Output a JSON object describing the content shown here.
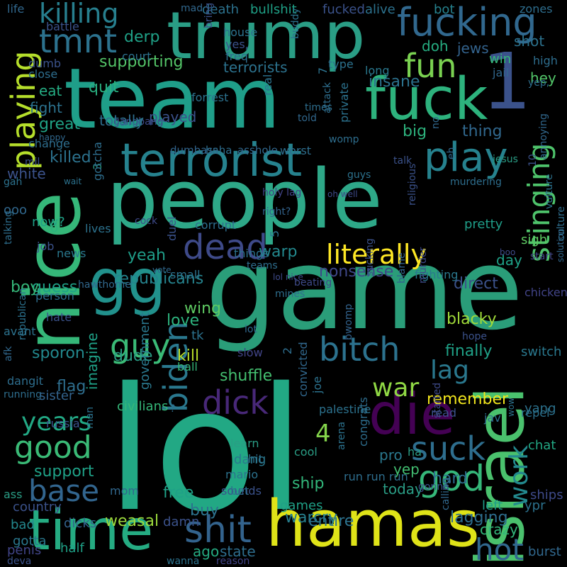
{
  "background": "#000000",
  "words": [
    {
      "text": "lol",
      "color": "#22a884"
    },
    {
      "text": "game",
      "color": "#2a9d79"
    },
    {
      "text": "people",
      "color": "#2ea888"
    },
    {
      "text": "team",
      "color": "#1f9e89"
    },
    {
      "text": "nice",
      "color": "#35b779"
    },
    {
      "text": "israel",
      "color": "#4ac16d"
    },
    {
      "text": "hamas",
      "color": "#dfe318"
    },
    {
      "text": "trump",
      "color": "#2a9d85"
    },
    {
      "text": "fuck",
      "color": "#2db27d"
    },
    {
      "text": "terrorist",
      "color": "#26828e"
    },
    {
      "text": "gg",
      "color": "#21918c"
    },
    {
      "text": "time",
      "color": "#25ab82"
    },
    {
      "text": "fucking",
      "color": "#31688e"
    },
    {
      "text": "1",
      "color": "#3b528b"
    },
    {
      "text": "die",
      "color": "#440154"
    },
    {
      "text": "bitch",
      "color": "#2c728e"
    },
    {
      "text": "dead",
      "color": "#3e4a89"
    },
    {
      "text": "literally",
      "color": "#fde725"
    },
    {
      "text": "shit",
      "color": "#33638d"
    },
    {
      "text": "play",
      "color": "#26828e"
    },
    {
      "text": "fun",
      "color": "#7ad151"
    },
    {
      "text": "stinging",
      "color": "#4ec36b"
    },
    {
      "text": "tmnt",
      "color": "#2c728e"
    },
    {
      "text": "killing",
      "color": "#277f8e"
    },
    {
      "text": "playing",
      "color": "#b5de2b"
    },
    {
      "text": "guy",
      "color": "#3aba76"
    },
    {
      "text": "biden",
      "color": "#2a788e"
    },
    {
      "text": "dick",
      "color": "#482878"
    },
    {
      "text": "good",
      "color": "#3aba76"
    },
    {
      "text": "base",
      "color": "#32658e"
    },
    {
      "text": "god",
      "color": "#35b779"
    },
    {
      "text": "suck",
      "color": "#2e6e8e"
    },
    {
      "text": "hot",
      "color": "#31688e"
    },
    {
      "text": "work",
      "color": "#23898e"
    },
    {
      "text": "war",
      "color": "#8fd744"
    },
    {
      "text": "lag",
      "color": "#2a788e"
    },
    {
      "text": "years",
      "color": "#22a884"
    },
    {
      "text": "4",
      "color": "#84d44b"
    },
    {
      "text": "supporting",
      "color": "#54c568"
    },
    {
      "text": "terrorists",
      "color": "#2c728e"
    },
    {
      "text": "insane",
      "color": "#2c728e"
    },
    {
      "text": "republicans",
      "color": "#25838e"
    },
    {
      "text": "nonsense",
      "color": "#3f4889"
    },
    {
      "text": "yeah",
      "color": "#1f9e89"
    },
    {
      "text": "love",
      "color": "#2db27d"
    },
    {
      "text": "wing",
      "color": "#5ec962"
    },
    {
      "text": "guess",
      "color": "#1fa187"
    },
    {
      "text": "sporon",
      "color": "#23898e"
    },
    {
      "text": "shuffle",
      "color": "#44bf70"
    },
    {
      "text": "kill",
      "color": "#b8de29"
    },
    {
      "text": "killed",
      "color": "#2c728e"
    },
    {
      "text": "flag",
      "color": "#2e6e8e"
    },
    {
      "text": "great",
      "color": "#20a386"
    },
    {
      "text": "big",
      "color": "#2db27d"
    },
    {
      "text": "thing",
      "color": "#31688e"
    },
    {
      "text": "blacky",
      "color": "#a0da39"
    },
    {
      "text": "finally",
      "color": "#1fa187"
    },
    {
      "text": "switch",
      "color": "#2a788e"
    },
    {
      "text": "remember",
      "color": "#f1e51d"
    },
    {
      "text": "yang",
      "color": "#2c728e"
    },
    {
      "text": "hey",
      "color": "#52c569"
    },
    {
      "text": "sigh",
      "color": "#5ec962"
    },
    {
      "text": "day",
      "color": "#1fa187"
    },
    {
      "text": "pretty",
      "color": "#1f9e89"
    },
    {
      "text": "direct",
      "color": "#3b528b"
    },
    {
      "text": "warp",
      "color": "#23898e"
    },
    {
      "text": "dude",
      "color": "#2a9d85"
    },
    {
      "text": "boy",
      "color": "#35b779"
    },
    {
      "text": "played",
      "color": "#3b528b"
    },
    {
      "text": "quit",
      "color": "#29af7f"
    },
    {
      "text": "eat",
      "color": "#25ab82"
    },
    {
      "text": "fight",
      "color": "#2c728e"
    },
    {
      "text": "derp",
      "color": "#1fa187"
    },
    {
      "text": "doh",
      "color": "#26ad81"
    },
    {
      "text": "jews",
      "color": "#33638d"
    },
    {
      "text": "shot",
      "color": "#2c728e"
    },
    {
      "text": "win",
      "color": "#35b779"
    },
    {
      "text": "yep",
      "color": "#42be71"
    },
    {
      "text": "pro",
      "color": "#2a788e"
    },
    {
      "text": "ship",
      "color": "#32b67a"
    },
    {
      "text": "hard",
      "color": "#2e6e8e"
    },
    {
      "text": "today",
      "color": "#2a9d85"
    },
    {
      "text": "free",
      "color": "#1fa187"
    },
    {
      "text": "buy",
      "color": "#2c728e"
    },
    {
      "text": "weasal",
      "color": "#9bd93c"
    },
    {
      "text": "warcry",
      "color": "#277f8e"
    },
    {
      "text": "lagging",
      "color": "#2e6e8e"
    },
    {
      "text": "crazy",
      "color": "#32b67a"
    },
    {
      "text": "entire",
      "color": "#2c728e"
    },
    {
      "text": "support",
      "color": "#1fa187"
    },
    {
      "text": "country",
      "color": "#3b528b"
    },
    {
      "text": "bad",
      "color": "#23898e"
    },
    {
      "text": "gotta",
      "color": "#2a788e"
    },
    {
      "text": "penis",
      "color": "#414487"
    },
    {
      "text": "half",
      "color": "#1fa187"
    },
    {
      "text": "ago",
      "color": "#25ab82"
    },
    {
      "text": "state",
      "color": "#2e6e8e"
    },
    {
      "text": "damn",
      "color": "#3b528b"
    },
    {
      "text": "dicks",
      "color": "#33638d"
    },
    {
      "text": "games",
      "color": "#1fa187"
    },
    {
      "text": "left",
      "color": "#1f9e89"
    },
    {
      "text": "ypr",
      "color": "#2c728e"
    },
    {
      "text": "burst",
      "color": "#31688e"
    },
    {
      "text": "chat",
      "color": "#22a884"
    },
    {
      "text": "ships",
      "color": "#3e4a89"
    },
    {
      "text": "death",
      "color": "#2c728e"
    },
    {
      "text": "bullshit",
      "color": "#1fa187"
    },
    {
      "text": "fucked",
      "color": "#3b528b"
    },
    {
      "text": "alive",
      "color": "#2c728e"
    },
    {
      "text": "bot",
      "color": "#26828e"
    },
    {
      "text": "zones",
      "color": "#2e6e8e"
    },
    {
      "text": "house",
      "color": "#2c728e"
    },
    {
      "text": "life",
      "color": "#31688e"
    },
    {
      "text": "battle",
      "color": "#3b528b"
    },
    {
      "text": "court",
      "color": "#2c728e"
    },
    {
      "text": "dumb",
      "color": "#3b528b"
    },
    {
      "text": "close",
      "color": "#2e6e8e"
    },
    {
      "text": "high",
      "color": "#2e6e8e"
    },
    {
      "text": "jail",
      "color": "#31688e"
    },
    {
      "text": "long",
      "color": "#2a788e"
    },
    {
      "text": "type",
      "color": "#2c728e"
    },
    {
      "text": "yes,",
      "color": "#3b528b"
    },
    {
      "text": "freq",
      "color": "#2e6e8e"
    },
    {
      "text": "mad",
      "color": "#31688e"
    },
    {
      "text": "bring",
      "color": "#3b528b"
    },
    {
      "text": "buddy",
      "color": "#2c728e"
    },
    {
      "text": "forrest",
      "color": "#2c728e"
    },
    {
      "text": "dumbass",
      "color": "#32658e"
    },
    {
      "text": "haha",
      "color": "#2e6e8e"
    },
    {
      "text": "asshole",
      "color": "#31688e"
    },
    {
      "text": "change",
      "color": "#2e6e8e"
    },
    {
      "text": "mil",
      "color": "#3b528b"
    },
    {
      "text": "gah",
      "color": "#2c728e"
    },
    {
      "text": "ooo",
      "color": "#31688e"
    },
    {
      "text": "now?",
      "color": "#1fa187"
    },
    {
      "text": "6",
      "color": "#2db27d"
    },
    {
      "text": "lives",
      "color": "#2c728e"
    },
    {
      "text": "news",
      "color": "#2a788e"
    },
    {
      "text": "job",
      "color": "#3b528b"
    },
    {
      "text": "talking",
      "color": "#2e6e8e"
    },
    {
      "text": "hawthorne",
      "color": "#31688e"
    },
    {
      "text": "small",
      "color": "#2c728e"
    },
    {
      "text": "fighting",
      "color": "#2a788e"
    },
    {
      "text": "chicken",
      "color": "#414487"
    },
    {
      "text": "murder",
      "color": "#3e4a89"
    },
    {
      "text": "blame",
      "color": "#33638d"
    },
    {
      "text": "sucking",
      "color": "#3b528b"
    },
    {
      "text": "beating",
      "color": "#3e4a89"
    },
    {
      "text": "mines",
      "color": "#2e6e8e"
    },
    {
      "text": "lot",
      "color": "#31688e"
    },
    {
      "text": "slow",
      "color": "#414487"
    },
    {
      "text": "tk",
      "color": "#2c728e"
    },
    {
      "text": "ball",
      "color": "#35b779"
    },
    {
      "text": "person",
      "color": "#2e6e8e"
    },
    {
      "text": "hate",
      "color": "#3b528b"
    },
    {
      "text": "avant",
      "color": "#2c728e"
    },
    {
      "text": "afk",
      "color": "#31688e"
    },
    {
      "text": "republican",
      "color": "#2c728e"
    },
    {
      "text": "running",
      "color": "#2e6e8e"
    },
    {
      "text": "russia",
      "color": "#3b528b"
    },
    {
      "text": "sister",
      "color": "#33638d"
    },
    {
      "text": "imagine",
      "color": "#1fa187"
    },
    {
      "text": "civilians",
      "color": "#35b779"
    },
    {
      "text": "government",
      "color": "#2a788e"
    },
    {
      "text": "learn",
      "color": "#2a9d85"
    },
    {
      "text": "dang",
      "color": "#2a788e"
    },
    {
      "text": "hit",
      "color": "#2c728e"
    },
    {
      "text": "mario",
      "color": "#2c728e"
    },
    {
      "text": "sounds",
      "color": "#3b528b"
    },
    {
      "text": "bet",
      "color": "#2e6e8e"
    },
    {
      "text": "mom",
      "color": "#31688e"
    },
    {
      "text": "ass",
      "color": "#2a9d85"
    },
    {
      "text": "deva",
      "color": "#3b528b"
    },
    {
      "text": "wanna",
      "color": "#2c728e"
    },
    {
      "text": "reason",
      "color": "#414487"
    },
    {
      "text": "congrats",
      "color": "#2e6e8e"
    },
    {
      "text": "arena",
      "color": "#2c728e"
    },
    {
      "text": "run run run",
      "color": "#2e6e8e"
    },
    {
      "text": "cool",
      "color": "#2a9d85"
    },
    {
      "text": "convicted",
      "color": "#31688e"
    },
    {
      "text": "joe",
      "color": "#2c728e"
    },
    {
      "text": "palestine",
      "color": "#2c728e"
    },
    {
      "text": "ha",
      "color": "#2a9d85"
    },
    {
      "text": "read",
      "color": "#3b528b"
    },
    {
      "text": "started",
      "color": "#3e4a89"
    },
    {
      "text": "calling",
      "color": "#31688e"
    },
    {
      "text": "gonna",
      "color": "#3b528b"
    },
    {
      "text": "jav",
      "color": "#2e6e8e"
    },
    {
      "text": "wow",
      "color": "#2c728e"
    },
    {
      "text": "repel",
      "color": "#2c728e"
    },
    {
      "text": "hope",
      "color": "#3b528b"
    },
    {
      "text": "culture",
      "color": "#2e6e8e"
    },
    {
      "text": "solution",
      "color": "#31688e"
    },
    {
      "text": "vulture",
      "color": "#2c728e"
    },
    {
      "text": "start",
      "color": "#414487"
    },
    {
      "text": "boo",
      "color": "#3e4a89"
    },
    {
      "text": "annoying",
      "color": "#31688e"
    },
    {
      "text": "yep,",
      "color": "#2e6e8e"
    },
    {
      "text": "10",
      "color": "#3b528b"
    },
    {
      "text": "talk",
      "color": "#3b528b"
    },
    {
      "text": "no,",
      "color": "#31688e"
    },
    {
      "text": "private",
      "color": "#2c728e"
    },
    {
      "text": "womp",
      "color": "#2e6e8e"
    },
    {
      "text": "times",
      "color": "#2e6e8e"
    },
    {
      "text": "told",
      "color": "#31688e"
    },
    {
      "text": "7",
      "color": "#2c728e"
    },
    {
      "text": "attack",
      "color": "#2e6e8e"
    },
    {
      "text": "real",
      "color": "#2c728e"
    },
    {
      "text": "gangbang",
      "color": "#3e4a89"
    },
    {
      "text": "happy",
      "color": "#31688e"
    },
    {
      "text": "totally",
      "color": "#2e6e8e"
    },
    {
      "text": "3",
      "color": "#2a9d85"
    },
    {
      "text": "gotcha",
      "color": "#2e6e8e"
    },
    {
      "text": "duel",
      "color": "#3b528b"
    },
    {
      "text": "corrupt",
      "color": "#2e6e8e"
    },
    {
      "text": "things",
      "color": "#2c728e"
    },
    {
      "text": "teams",
      "color": "#2e6e8e"
    },
    {
      "text": "vote",
      "color": "#31688e"
    },
    {
      "text": "lol nice",
      "color": "#3e4a89"
    },
    {
      "text": "oh well",
      "color": "#3e4a89"
    },
    {
      "text": "holy lag",
      "color": "#414487"
    },
    {
      "text": "right?",
      "color": "#33638d"
    },
    {
      "text": "cock",
      "color": "#3e4a89"
    },
    {
      "text": "religious",
      "color": "#3b528b"
    },
    {
      "text": "eh",
      "color": "#31688e"
    },
    {
      "text": "murdering",
      "color": "#2e6e8e"
    },
    {
      "text": "jesus",
      "color": "#2a9d85"
    },
    {
      "text": "guys",
      "color": "#2c728e"
    },
    {
      "text": "dangit",
      "color": "#2e6e8e"
    },
    {
      "text": "wait",
      "color": "#2c728e"
    },
    {
      "text": "white",
      "color": "#3b528b"
    },
    {
      "text": "5",
      "color": "#2c728e"
    },
    {
      "text": "2",
      "color": "#2e6e8e"
    },
    {
      "text": "bwomp",
      "color": "#33638d"
    },
    {
      "text": "?",
      "color": "#2e6e8e"
    },
    {
      "text": "man",
      "color": "#2c728e"
    },
    {
      "text": "worst",
      "color": "#2e6e8e"
    },
    {
      "text": "arguing",
      "color": "#3b528b"
    },
    {
      "text": "bounty",
      "color": "#3e4a89"
    },
    {
      "text": "biggest",
      "color": "#33638d"
    },
    {
      "text": "ez",
      "color": "#2c728e"
    }
  ]
}
